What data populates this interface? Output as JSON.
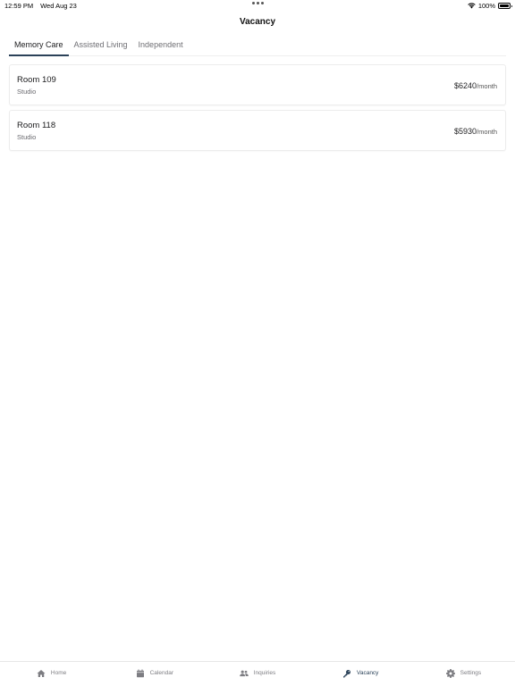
{
  "status_bar": {
    "time": "12:59 PM",
    "date": "Wed Aug 23",
    "battery": "100%",
    "battery_level": 1.0
  },
  "header": {
    "title": "Vacancy"
  },
  "tabs": [
    {
      "label": "Memory Care",
      "active": true
    },
    {
      "label": "Assisted Living",
      "active": false
    },
    {
      "label": "Independent",
      "active": false
    }
  ],
  "rooms": [
    {
      "name": "Room 109",
      "type": "Studio",
      "price": "$6240",
      "per": "/month"
    },
    {
      "name": "Room 118",
      "type": "Studio",
      "price": "$5930",
      "per": "/month"
    }
  ],
  "tabbar": {
    "items": [
      {
        "label": "Home",
        "icon": "home-icon",
        "active": false
      },
      {
        "label": "Calendar",
        "icon": "calendar-icon",
        "active": false
      },
      {
        "label": "Inquiries",
        "icon": "people-icon",
        "active": false
      },
      {
        "label": "Vacancy",
        "icon": "key-icon",
        "active": true
      },
      {
        "label": "Settings",
        "icon": "gear-icon",
        "active": false
      }
    ]
  },
  "colors": {
    "accent": "#2b4259",
    "inactive": "#7d7d82"
  }
}
